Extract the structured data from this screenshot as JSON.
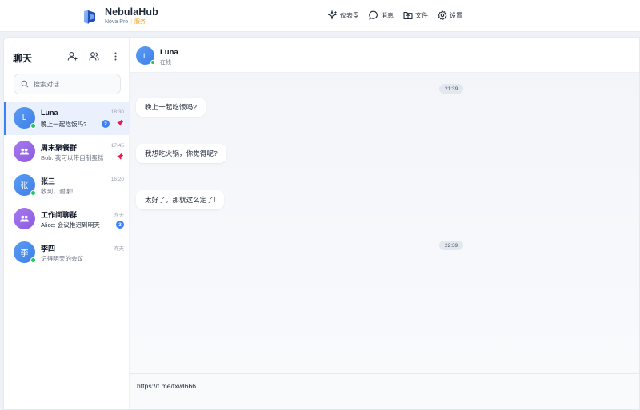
{
  "brand": {
    "name": "NebulaHub",
    "edition": "Nova Pro",
    "tag": "服务",
    "colors": {
      "primary": "#3b82f6",
      "accent": "#f59e0b",
      "online": "#22c55e"
    }
  },
  "nav": [
    {
      "label": "仪表盘",
      "icon": "sparkle-icon"
    },
    {
      "label": "消息",
      "icon": "chat-bubble-icon"
    },
    {
      "label": "文件",
      "icon": "folder-icon"
    },
    {
      "label": "设置",
      "icon": "gear-icon"
    }
  ],
  "sidebar": {
    "title": "聊天",
    "search_placeholder": "搜索对话...",
    "conversations": [
      {
        "name": "Luna",
        "avatar_text": "L",
        "time": "18:30",
        "preview": "晚上一起吃饭吗?",
        "unread": "2",
        "pinned": true,
        "online": true,
        "group": false,
        "active": true
      },
      {
        "name": "周末聚餐群",
        "avatar_text": "",
        "time": "17:45",
        "preview": "Bob: 我可以带自制蛋糕",
        "unread": "",
        "pinned": true,
        "online": false,
        "group": true,
        "active": false
      },
      {
        "name": "张三",
        "avatar_text": "张",
        "time": "16:20",
        "preview": "收到，谢谢!",
        "unread": "",
        "pinned": false,
        "online": true,
        "group": false,
        "active": false
      },
      {
        "name": "工作间聊群",
        "avatar_text": "",
        "time": "昨天",
        "preview": "Alice: 会议推迟到明天",
        "unread": "3",
        "pinned": false,
        "online": false,
        "group": true,
        "active": false
      },
      {
        "name": "李四",
        "avatar_text": "李",
        "time": "昨天",
        "preview": "记得明天的会议",
        "unread": "",
        "pinned": false,
        "online": true,
        "group": false,
        "active": false
      }
    ]
  },
  "chat": {
    "contact_name": "Luna",
    "avatar_text": "L",
    "status": "在线",
    "timestamps": [
      "21:39",
      "22:39"
    ],
    "messages": [
      "晚上一起吃饭吗?",
      "我想吃火锅，你觉得呢?",
      "太好了，那就这么定了!"
    ],
    "composer_text": "https://t.me/txwl666"
  }
}
